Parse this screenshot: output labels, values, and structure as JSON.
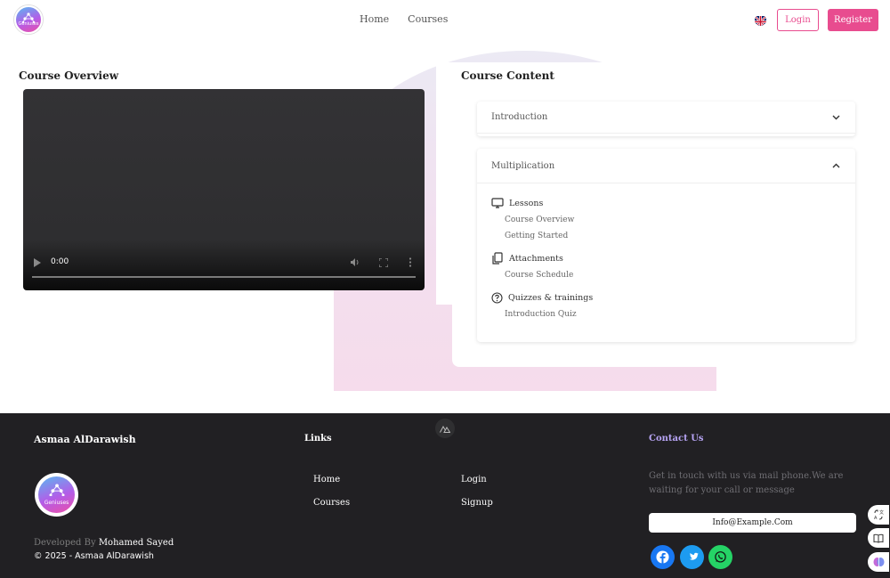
{
  "header": {
    "logo_text": "Geniuses",
    "nav": [
      "Home",
      "Courses"
    ],
    "login": "Login",
    "register": "Register"
  },
  "overview": {
    "title": "Course Overview",
    "video_time": "0:00"
  },
  "content": {
    "title": "Course Content",
    "sections": [
      {
        "label": "Introduction",
        "expanded": false
      },
      {
        "label": "Multiplication",
        "expanded": true
      }
    ],
    "lessons_title": "Lessons",
    "lessons": [
      "Course Overview",
      "Getting Started"
    ],
    "attachments_title": "Attachments",
    "attachments": [
      "Course Schedule"
    ],
    "quizzes_title": "Quizzes & trainings",
    "quizzes": [
      "Introduction Quiz"
    ]
  },
  "footer": {
    "name": "Asmaa AlDarawish",
    "logo_text": "Geniuses",
    "developed_by": "Developed By",
    "developer": "Mohamed Sayed",
    "copyright": "© 2025 - Asmaa AlDarawish",
    "links_title": "Links",
    "links": [
      "Home",
      "Courses",
      "Login",
      "Signup"
    ],
    "contact_title": "Contact Us",
    "contact_text": "Get in touch with us via mail phone.We are waiting for your call or message",
    "email": "Info@Example.Com",
    "social": [
      "facebook-icon",
      "twitter-icon",
      "whatsapp-icon"
    ]
  },
  "colors": {
    "accent": "#e84c8f",
    "footer_bg": "#212023",
    "contact_title": "#b7a4f4",
    "facebook": "#1877f2",
    "twitter": "#1d9bf0",
    "whatsapp": "#25d366"
  }
}
